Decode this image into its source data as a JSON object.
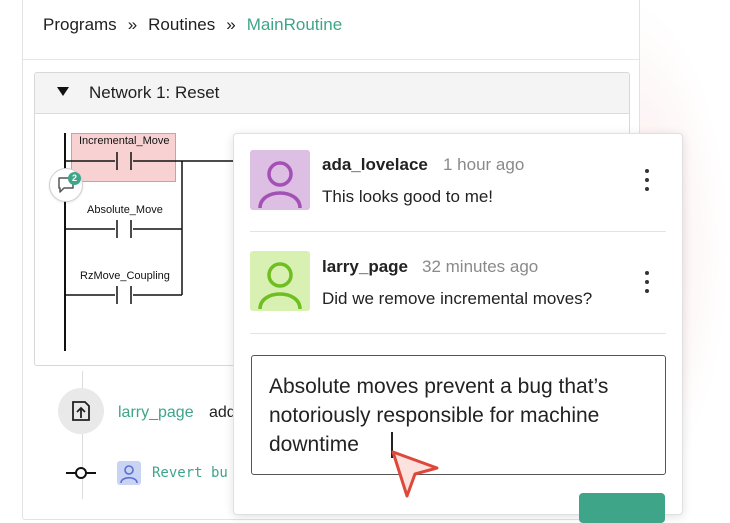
{
  "breadcrumb": {
    "items": [
      "Programs",
      "Routines"
    ],
    "separator": "»",
    "current": "MainRoutine"
  },
  "network": {
    "title": "Network 1: Reset",
    "contacts": [
      {
        "label": "Incremental_Move",
        "highlighted": true
      },
      {
        "label": "Absolute_Move",
        "highlighted": false
      },
      {
        "label": "RzMove_Coupling",
        "highlighted": false
      }
    ],
    "comment_count": "2"
  },
  "comments": [
    {
      "user": "ada_lovelace",
      "time": "1 hour ago",
      "text": "This looks good to me!",
      "avatar_color": "#ddbfe3",
      "avatar_fg": "#a451b5"
    },
    {
      "user": "larry_page",
      "time": "32 minutes ago",
      "text": "Did we remove incremental moves?",
      "avatar_color": "#d8f0b2",
      "avatar_fg": "#6fbe22"
    }
  ],
  "reply": {
    "value": "Absolute moves prevent a bug that’s\nnotoriously responsible for machine\ndowntime"
  },
  "history": {
    "entry_user": "larry_page",
    "entry_text": "add",
    "revert_text": "Revert bu"
  },
  "colors": {
    "accent": "#3ea589",
    "highlight": "#f8d2d2",
    "cursor": "#e0473b"
  }
}
